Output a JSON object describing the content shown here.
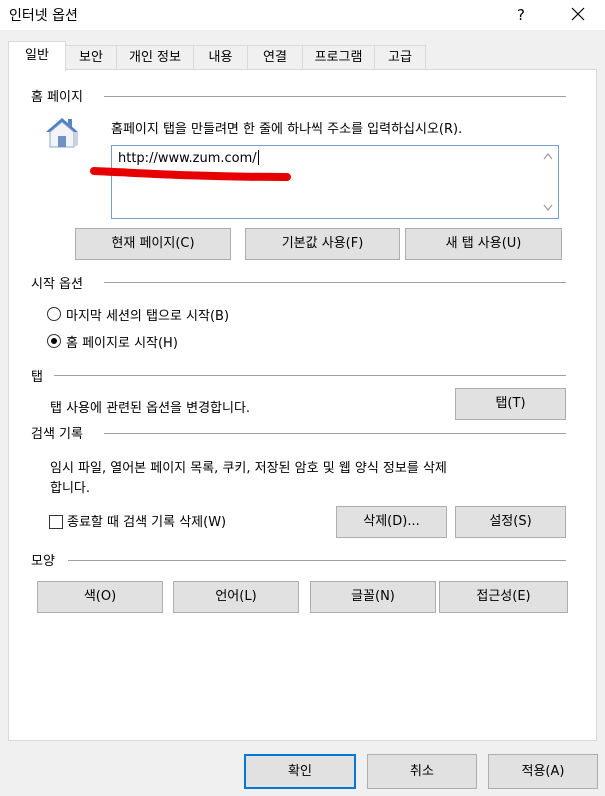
{
  "window": {
    "title": "인터넷 옵션",
    "help_label": "?"
  },
  "tabs": [
    {
      "label": "일반",
      "active": true
    },
    {
      "label": "보안"
    },
    {
      "label": "개인 정보"
    },
    {
      "label": "내용"
    },
    {
      "label": "연결"
    },
    {
      "label": "프로그램"
    },
    {
      "label": "고급"
    }
  ],
  "homepage": {
    "heading": "홈 페이지",
    "description": "홈페이지 탭을 만들려면 한 줄에 하나씩 주소를 입력하십시오(R).",
    "url": "http://www.zum.com/",
    "use_current_label": "현재 페이지(C)",
    "use_default_label": "기본값 사용(F)",
    "use_new_tab_label": "새 탭 사용(U)"
  },
  "startup": {
    "heading": "시작 옵션",
    "option_last_session": "마지막 세션의 탭으로 시작(B)",
    "option_homepage": "홈 페이지로 시작(H)"
  },
  "tabs_section": {
    "heading": "탭",
    "description": "탭 사용에 관련된 옵션을 변경합니다.",
    "button_label": "탭(T)"
  },
  "history": {
    "heading": "검색 기록",
    "description_line1": "임시 파일, 열어본 페이지 목록, 쿠키, 저장된 암호 및 웹 양식 정보를 삭제",
    "description_line2": "합니다.",
    "delete_on_exit_label": "종료할 때 검색 기록 삭제(W)",
    "delete_label": "삭제(D)...",
    "settings_label": "설정(S)"
  },
  "appearance": {
    "heading": "모양",
    "colors_label": "색(O)",
    "languages_label": "언어(L)",
    "fonts_label": "글꼴(N)",
    "accessibility_label": "접근성(E)"
  },
  "footer": {
    "ok_label": "확인",
    "cancel_label": "취소",
    "apply_label": "적용(A)"
  },
  "colors": {
    "annotation_red": "#e60000",
    "focus_blue": "#0078d7"
  }
}
